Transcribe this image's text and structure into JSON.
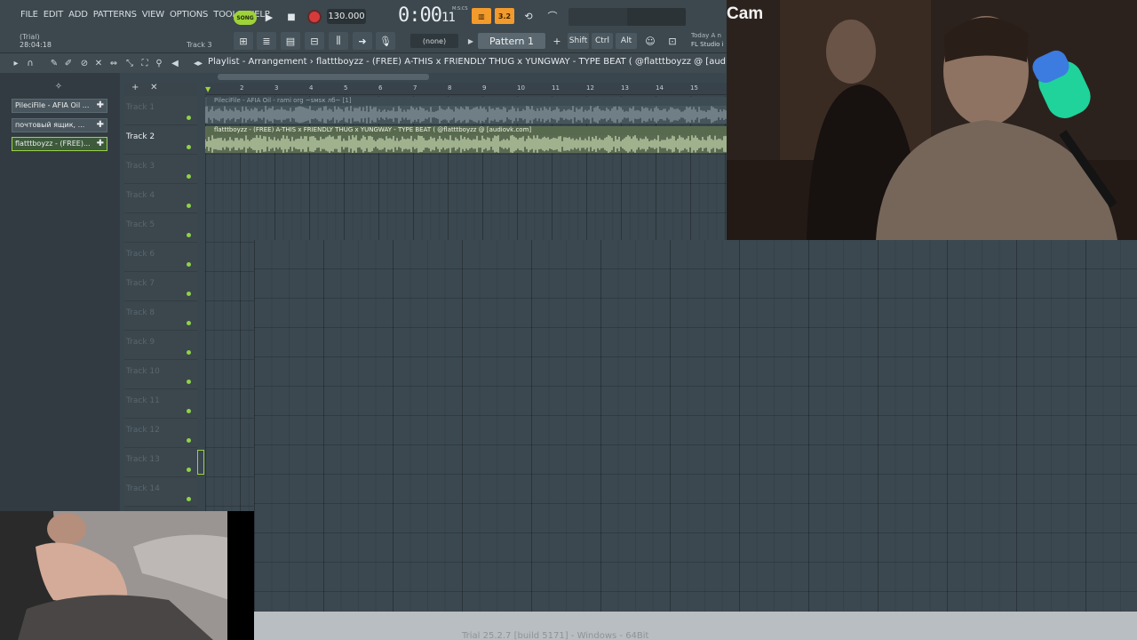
{
  "menu": [
    "FILE",
    "EDIT",
    "ADD",
    "PATTERNS",
    "VIEW",
    "OPTIONS",
    "TOOLS",
    "HELP"
  ],
  "hint": {
    "line1": "(Trial)",
    "line2": "28:04:18",
    "right": "Track 3"
  },
  "transport": {
    "song_label": "SONG",
    "tempo": "130.000",
    "time": "0:00",
    "time_small": "11",
    "time_unit": "M:S:CS"
  },
  "pattern": {
    "selector": "(none)",
    "name": "Pattern 1"
  },
  "modifiers": [
    "Shift",
    "Ctrl",
    "Alt"
  ],
  "news": {
    "line1": "Today  A n",
    "line2": "FL Studio i"
  },
  "playlist": {
    "title": "Playlist - Arrangement  ›  flatttboyzz - (FREE) A-THIS x FRIENDLY THUG x YUNGWAY - TYPE BEAT ( @flatttboyzz @ [aud"
  },
  "browser": {
    "items": [
      {
        "label": "PileciFile - AFIA Oil ..."
      },
      {
        "label": "почтовый ящик, ..."
      },
      {
        "label": "flatttboyzz - (FREE)..."
      }
    ]
  },
  "ruler": [
    "2",
    "3",
    "4",
    "5",
    "6",
    "7",
    "8",
    "9",
    "10",
    "11",
    "12",
    "13",
    "14",
    "15"
  ],
  "tracks": [
    {
      "name": "Track 1"
    },
    {
      "name": "Track 2"
    },
    {
      "name": "Track 3"
    },
    {
      "name": "Track 4"
    },
    {
      "name": "Track 5"
    },
    {
      "name": "Track 6"
    },
    {
      "name": "Track 7"
    },
    {
      "name": "Track 8"
    },
    {
      "name": "Track 9"
    },
    {
      "name": "Track 10"
    },
    {
      "name": "Track 11"
    },
    {
      "name": "Track 12"
    },
    {
      "name": "Track 13"
    },
    {
      "name": "Track 14"
    }
  ],
  "clips": [
    {
      "label": "PileciFile - AFIA Oil - rami org ~ѕмѕк лб~ [1]"
    },
    {
      "label": "flatttboyzz - (FREE) A-THIS x FRIENDLY THUG x YUNGWAY - TYPE BEAT ( @flatttboyzz @ [audiovk.com]"
    }
  ],
  "webcam": {
    "label": "Cam"
  },
  "footer": {
    "text": "Trial  25.2.7 [build 5171] - Windows - 64Bit"
  },
  "colors": {
    "accent": "#9fd23a",
    "orange": "#f39a2c",
    "record": "#d63b3b"
  }
}
